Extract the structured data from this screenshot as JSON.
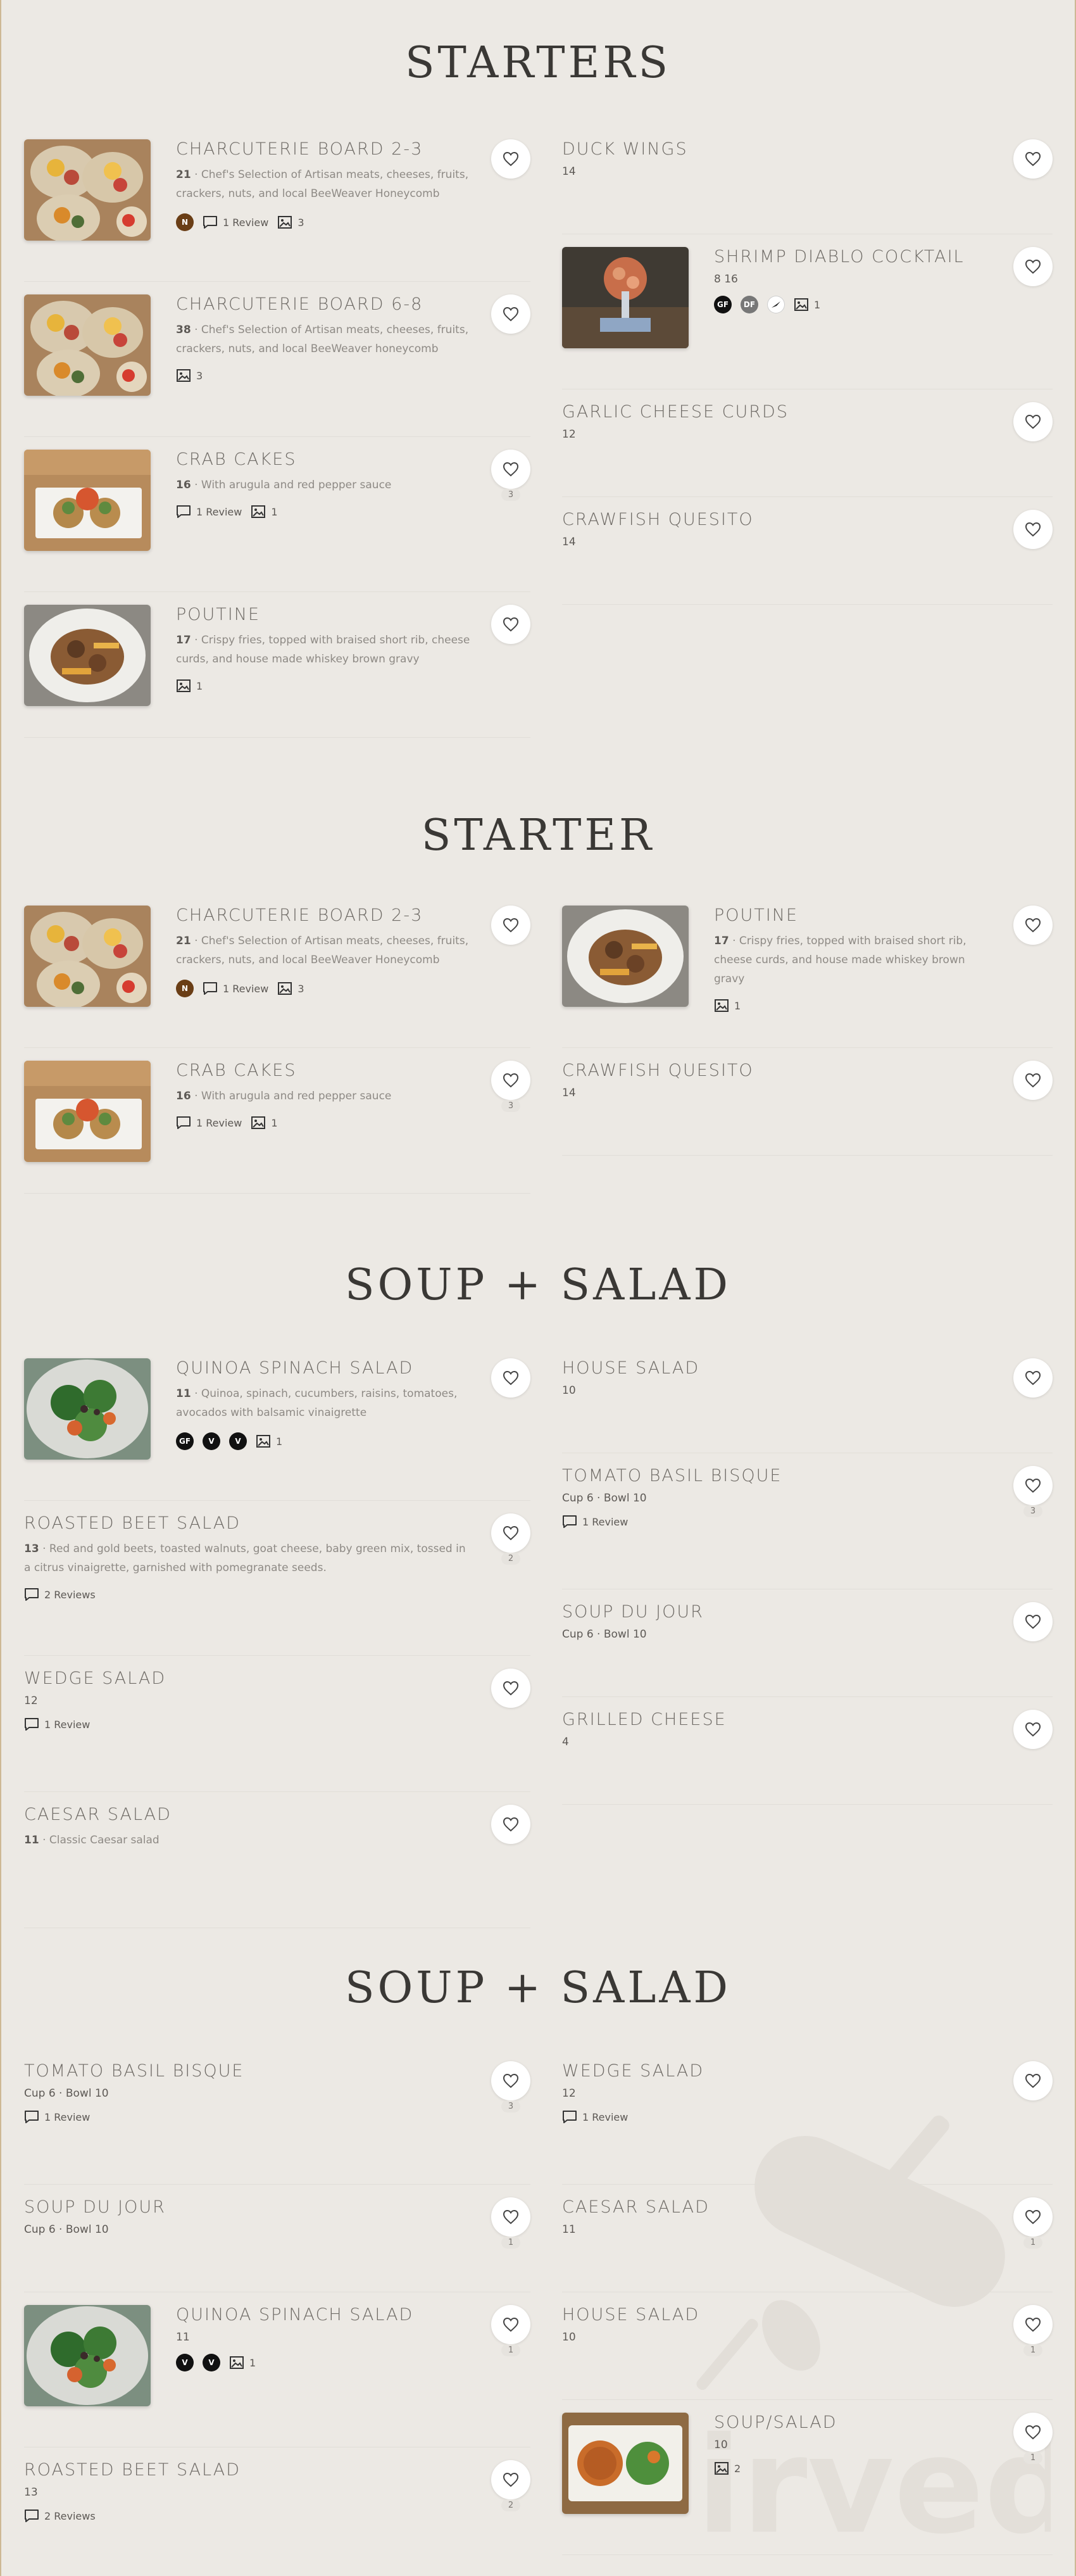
{
  "colors": {
    "background": "#ece9e4",
    "frame": "#cdb894",
    "title": "#3a3835",
    "item_name": "#6f6b66",
    "heart_bg": "#ffffff"
  },
  "sections": [
    {
      "title": "STARTERS",
      "left": [
        {
          "name": "CHARCUTERIE BOARD 2-3",
          "price": "21",
          "desc": "Chef's Selection of Artisan meats, cheeses, fruits, crackers, nuts, and local BeeWeaver Honeycomb",
          "badges": [
            "N"
          ],
          "reviews": "1 Review",
          "photos": "3",
          "has_image": true,
          "image": "charcuterie"
        },
        {
          "name": "CHARCUTERIE BOARD 6-8",
          "price": "38",
          "desc": "Chef's Selection of Artisan meats, cheeses, fruits, crackers, nuts, and local BeeWeaver honeycomb",
          "badges": [],
          "reviews": "",
          "photos": "3",
          "has_image": true,
          "image": "charcuterie"
        },
        {
          "name": "CRAB CAKES",
          "price": "16",
          "desc": "With arugula and red pepper sauce",
          "badges": [],
          "reviews": "1 Review",
          "photos": "1",
          "has_image": true,
          "image": "crabcakes",
          "likes": "3"
        },
        {
          "name": "POUTINE",
          "price": "17",
          "desc": "Crispy fries, topped with braised short rib, cheese curds, and house made whiskey brown gravy",
          "badges": [],
          "reviews": "",
          "photos": "1",
          "has_image": true,
          "image": "poutine"
        }
      ],
      "right": [
        {
          "name": "DUCK WINGS",
          "price": "14"
        },
        {
          "name": "SHRIMP DIABLO COCKTAIL",
          "price": "8 16",
          "badges": [
            "GF",
            "DF",
            "SP"
          ],
          "photos": "1",
          "has_image": true,
          "image": "shrimp"
        },
        {
          "name": "GARLIC CHEESE CURDS",
          "price": "12"
        },
        {
          "name": "CRAWFISH QUESITO",
          "price": "14"
        }
      ]
    },
    {
      "title": "STARTER",
      "left": [
        {
          "name": "CHARCUTERIE BOARD 2-3",
          "price": "21",
          "desc": "Chef's Selection of Artisan meats, cheeses, fruits, crackers, nuts, and local BeeWeaver Honeycomb",
          "badges": [
            "N"
          ],
          "reviews": "1 Review",
          "photos": "3",
          "image": "charcuterie"
        },
        {
          "name": "CRAB CAKES",
          "price": "16",
          "desc": "With arugula and red pepper sauce",
          "reviews": "1 Review",
          "photos": "1",
          "image": "crabcakes",
          "likes": "3"
        }
      ],
      "right": [
        {
          "name": "POUTINE",
          "price": "17",
          "desc": "Crispy fries, topped with braised short rib, cheese curds, and house made whiskey brown gravy",
          "photos": "1",
          "image": "poutine"
        },
        {
          "name": "CRAWFISH QUESITO",
          "price": "14"
        }
      ]
    },
    {
      "title": "SOUP + SALAD",
      "left": [
        {
          "name": "QUINOA SPINACH SALAD",
          "price": "11",
          "desc": "Quinoa, spinach, cucumbers, raisins, tomatoes, avocados with balsamic vinaigrette",
          "badges": [
            "GF",
            "V",
            "V"
          ],
          "photos": "1",
          "image": "salad"
        },
        {
          "name": "ROASTED BEET SALAD",
          "price": "13",
          "desc": "Red and gold beets, toasted walnuts, goat cheese, baby green mix, tossed in a citrus vinaigrette, garnished with pomegranate seeds.",
          "reviews": "2 Reviews",
          "likes": "2"
        },
        {
          "name": "WEDGE SALAD",
          "price": "12",
          "reviews": "1 Review"
        },
        {
          "name": "CAESAR SALAD",
          "price": "11",
          "desc": "Classic Caesar salad"
        }
      ],
      "right": [
        {
          "name": "HOUSE SALAD",
          "price": "10"
        },
        {
          "name": "TOMATO BASIL BISQUE",
          "price": "Cup 6 · Bowl 10",
          "reviews": "1 Review",
          "likes": "3"
        },
        {
          "name": "SOUP DU JOUR",
          "price": "Cup 6 · Bowl 10"
        },
        {
          "name": "GRILLED CHEESE",
          "price": "4"
        }
      ]
    },
    {
      "title": "SOUP + SALAD",
      "left": [
        {
          "name": "TOMATO BASIL BISQUE",
          "price": "Cup 6 · Bowl 10",
          "reviews": "1 Review",
          "likes": "3"
        },
        {
          "name": "SOUP DU JOUR",
          "price": "Cup 6 · Bowl 10",
          "likes": "1"
        },
        {
          "name": "QUINOA SPINACH SALAD",
          "price": "11",
          "badges": [
            "V",
            "V"
          ],
          "photos": "1",
          "image": "salad",
          "likes": "1"
        },
        {
          "name": "ROASTED BEET SALAD",
          "price": "13",
          "reviews": "2 Reviews",
          "likes": "2"
        }
      ],
      "right": [
        {
          "name": "WEDGE SALAD",
          "price": "12",
          "reviews": "1 Review"
        },
        {
          "name": "CAESAR SALAD",
          "price": "11",
          "likes": "1"
        },
        {
          "name": "HOUSE SALAD",
          "price": "10",
          "likes": "1"
        },
        {
          "name": "SOUP/SALAD",
          "price": "10",
          "photos": "2",
          "image": "soupsalad",
          "likes": "1"
        }
      ]
    }
  ],
  "watermark": {
    "text": "irved"
  }
}
